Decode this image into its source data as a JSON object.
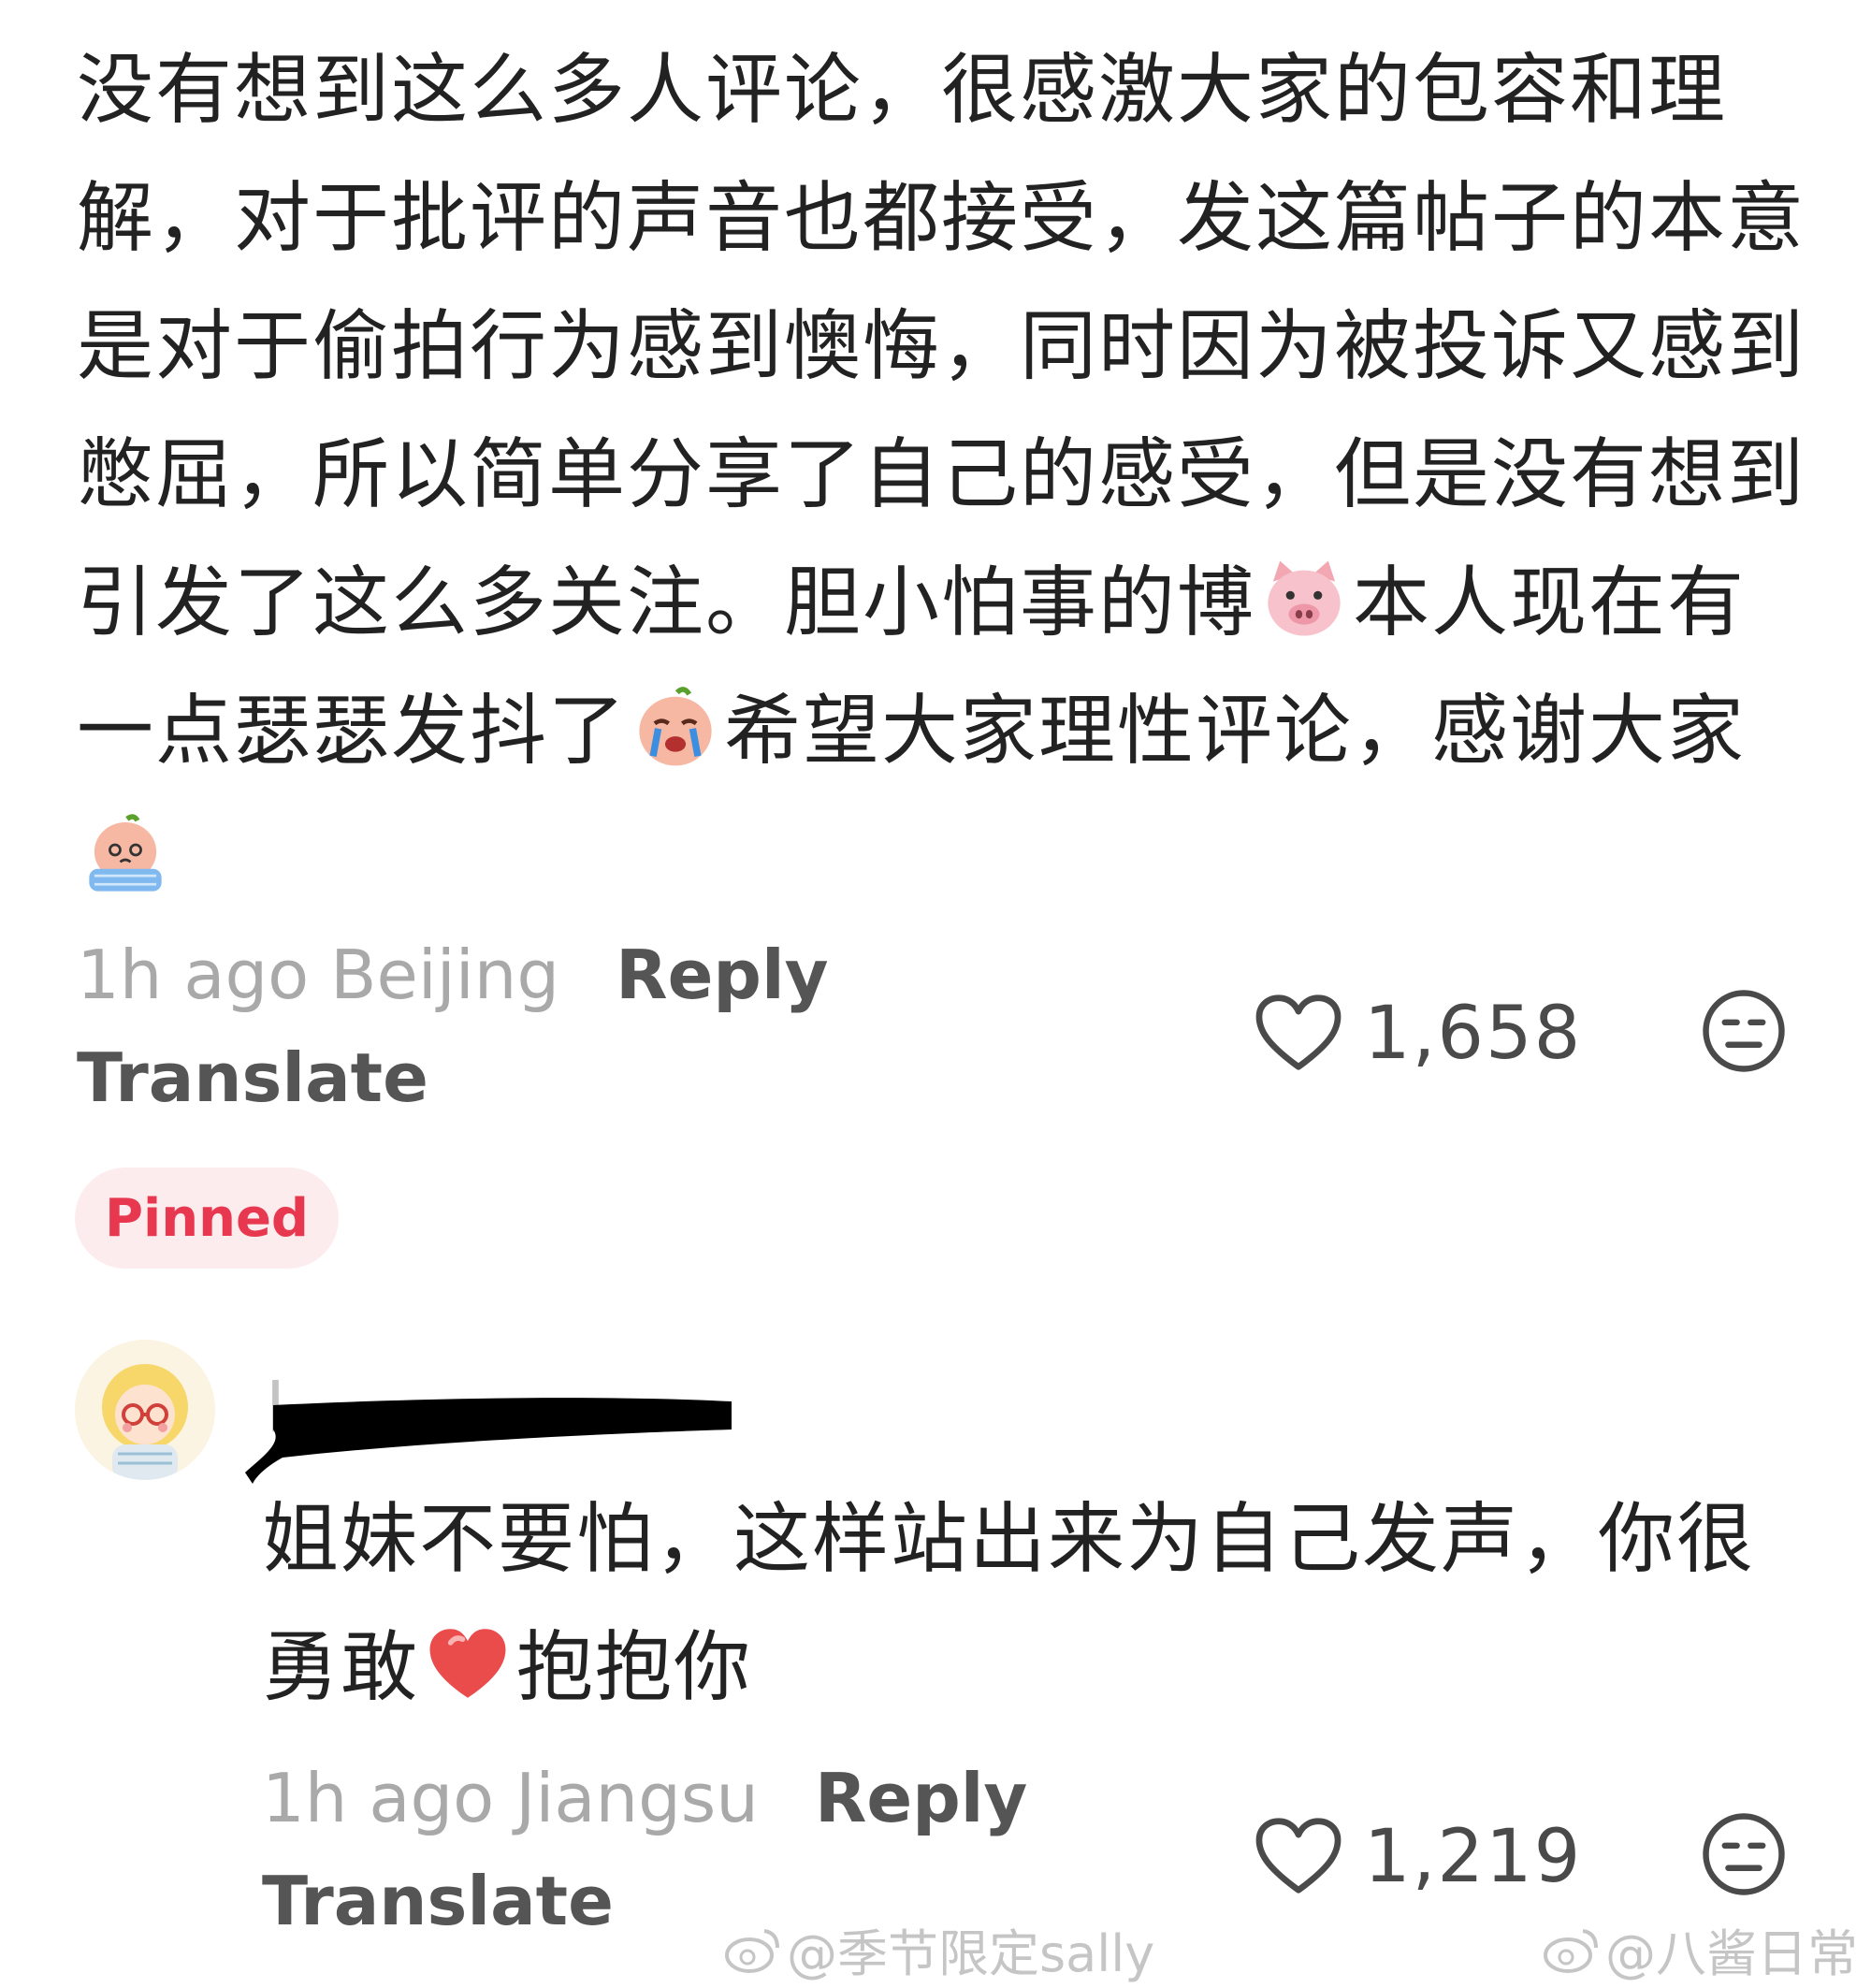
{
  "pinned_comment": {
    "text_before_pig": "没有想到这么多人评论，很感激大家的包容和理解，对于批评的声音也都接受，发这篇帖子的本意是对于偷拍行为感到懊悔，同时因为被投诉又感到憋屈，所以简单分享了自己的感受，但是没有想到引发了这么多关注。胆小怕事的博",
    "text_after_pig": "本人现在有一点瑟瑟发抖了",
    "text_after_crying": "希望大家理性评论，感谢大家",
    "time_location": "1h ago Beijing",
    "reply_label": "Reply",
    "translate_label": "Translate",
    "like_count": "1,658",
    "pinned_label": "Pinned",
    "emojis": [
      "pig-face-icon",
      "crying-face-icon",
      "tearful-face-icon"
    ]
  },
  "reply_comment": {
    "text_before_emoji": "姐妹不要怕，这样站出来为自己发声，你很勇敢",
    "text_after_emoji": "抱抱你",
    "time_location": "1h ago Jiangsu",
    "reply_label": "Reply",
    "translate_label": "Translate",
    "like_count": "1,219",
    "emojis": [
      "hug-heart-icon"
    ]
  },
  "watermarks": [
    "@季节限定sally",
    "@八酱日常"
  ],
  "colors": {
    "pinned_bg": "#fdecee",
    "pinned_text": "#e8384f",
    "meta_gray": "#a9a9a9"
  }
}
